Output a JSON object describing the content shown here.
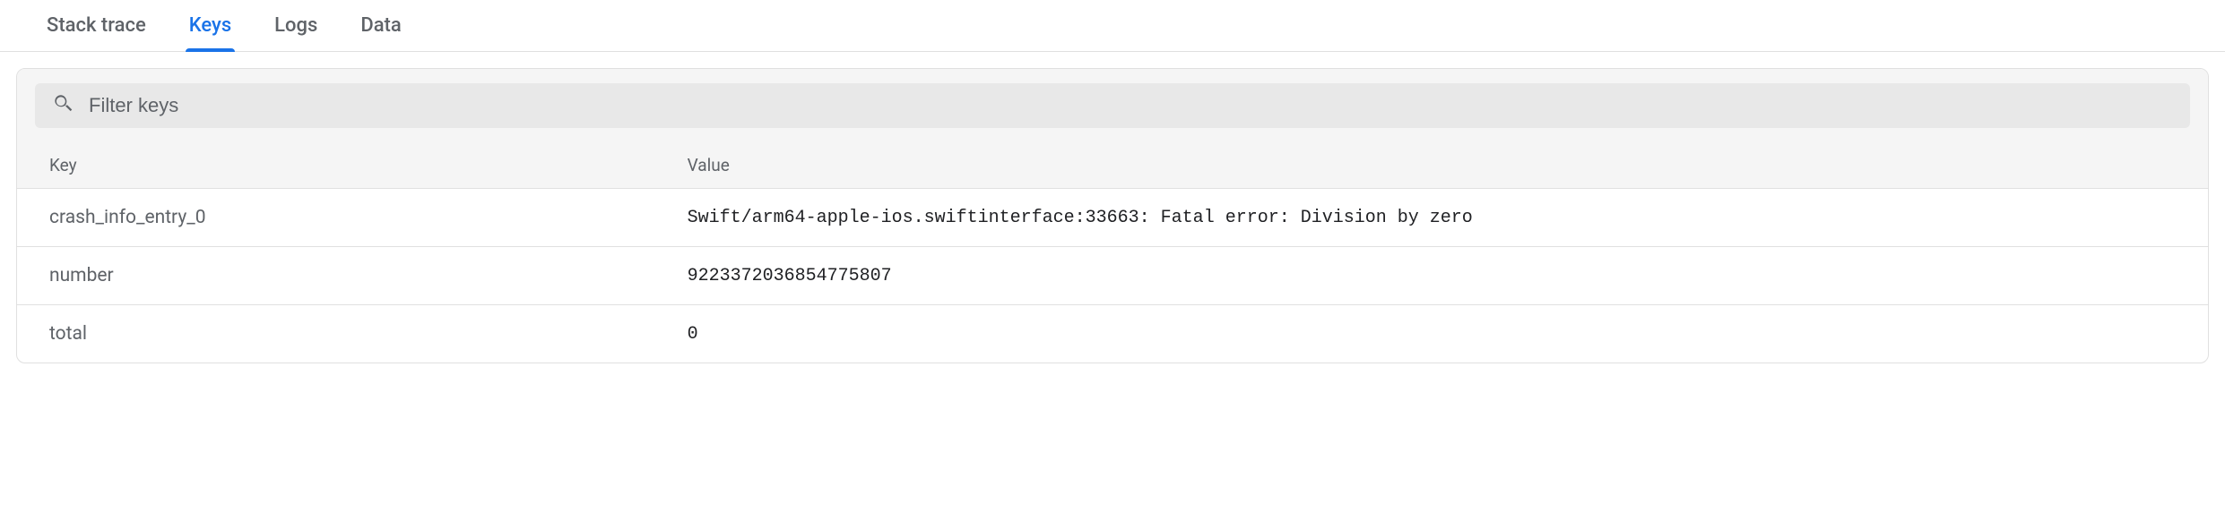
{
  "tabs": [
    {
      "label": "Stack trace",
      "active": false
    },
    {
      "label": "Keys",
      "active": true
    },
    {
      "label": "Logs",
      "active": false
    },
    {
      "label": "Data",
      "active": false
    }
  ],
  "filter": {
    "placeholder": "Filter keys",
    "value": ""
  },
  "table": {
    "header_key": "Key",
    "header_value": "Value",
    "rows": [
      {
        "key": "crash_info_entry_0",
        "value": "Swift/arm64-apple-ios.swiftinterface:33663: Fatal error: Division by zero"
      },
      {
        "key": "number",
        "value": "9223372036854775807"
      },
      {
        "key": "total",
        "value": "0"
      }
    ]
  }
}
